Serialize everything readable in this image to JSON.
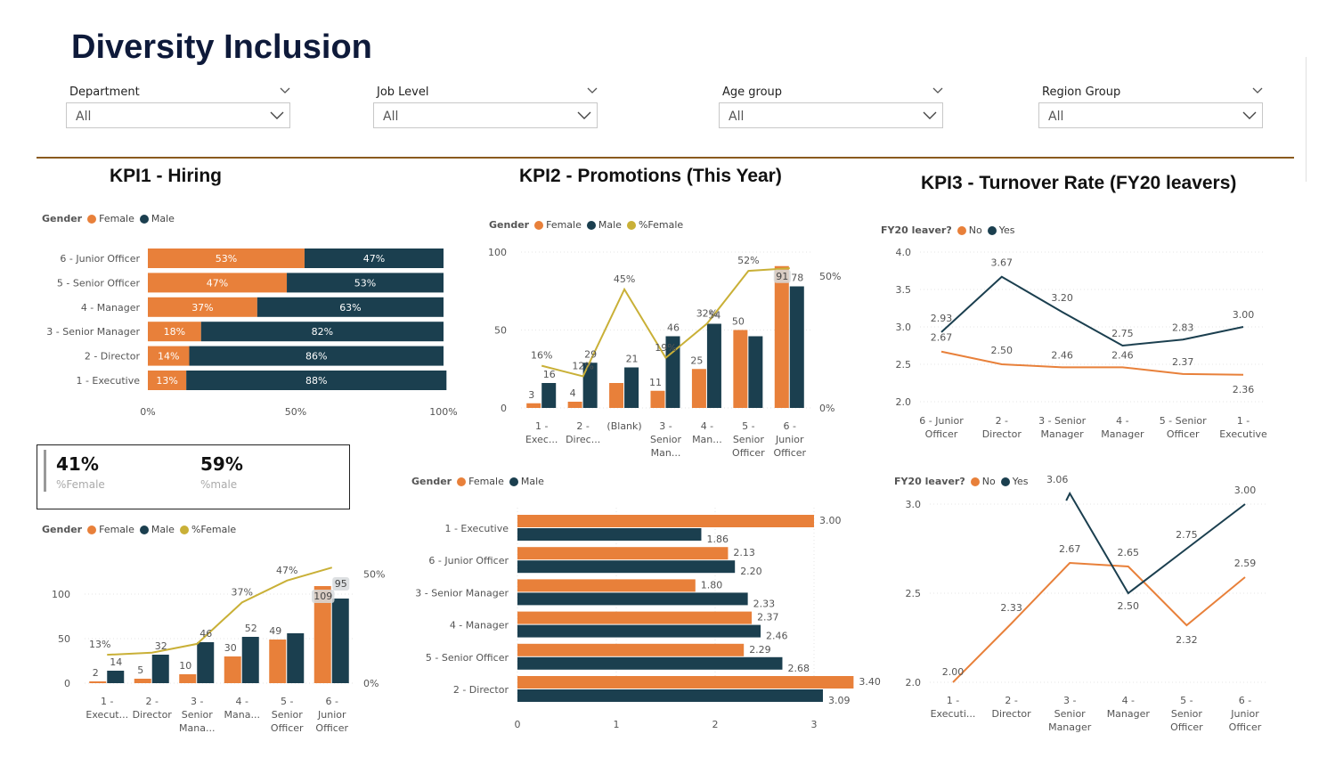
{
  "page": {
    "title": "Diversity Inclusion",
    "colors": {
      "female": "#e8803a",
      "male": "#1b3f4f",
      "pct": "#c9b037",
      "divider": "#8a5a1e"
    }
  },
  "filters": [
    {
      "label": "Department",
      "value": "All"
    },
    {
      "label": "Job Level",
      "value": "All"
    },
    {
      "label": "Age group",
      "value": "All"
    },
    {
      "label": "Region Group",
      "value": "All"
    }
  ],
  "sections": {
    "kpi1": "KPI1 - Hiring",
    "kpi2": "KPI2 - Promotions (This Year)",
    "kpi3": "KPI3 - Turnover Rate (FY20 leavers)"
  },
  "card": {
    "female_value": "41%",
    "female_label": "%Female",
    "male_value": "59%",
    "male_label": "%male"
  },
  "legends": {
    "gender": {
      "title": "Gender",
      "female": "Female",
      "male": "Male",
      "pct": "%Female"
    },
    "leaver": {
      "title": "FY20 leaver?",
      "no": "No",
      "yes": "Yes"
    }
  },
  "chart_data": [
    {
      "id": "hiring_stacked",
      "type": "bar",
      "orientation": "horizontal-stacked-100",
      "categories": [
        "6 - Junior Officer",
        "5 - Senior Officer",
        "4 - Manager",
        "3 - Senior Manager",
        "2 - Director",
        "1 - Executive"
      ],
      "series": [
        {
          "name": "Female",
          "values": [
            53,
            47,
            37,
            18,
            14,
            13
          ],
          "labels": [
            "53%",
            "47%",
            "37%",
            "18%",
            "14%",
            "13%"
          ]
        },
        {
          "name": "Male",
          "values": [
            47,
            53,
            63,
            82,
            86,
            88
          ],
          "labels": [
            "47%",
            "53%",
            "63%",
            "82%",
            "86%",
            "88%"
          ]
        }
      ],
      "xticks": [
        "0%",
        "50%",
        "100%"
      ],
      "xlim": [
        0,
        100
      ]
    },
    {
      "id": "hiring_combo",
      "type": "bar",
      "categories": [
        [
          "1 -",
          "Execut..."
        ],
        [
          "2 -",
          "Director"
        ],
        [
          "3 -",
          "Senior",
          "Mana..."
        ],
        [
          "4 -",
          "Mana..."
        ],
        [
          "5 -",
          "Senior",
          "Officer"
        ],
        [
          "6 -",
          "Junior",
          "Officer"
        ]
      ],
      "series": [
        {
          "name": "Female",
          "values": [
            2,
            5,
            10,
            30,
            49,
            109
          ]
        },
        {
          "name": "Male",
          "values": [
            14,
            32,
            46,
            52,
            56,
            95
          ]
        },
        {
          "name": "%Female",
          "type": "line",
          "values": [
            13,
            14,
            18,
            37,
            47,
            53
          ],
          "labels": [
            "13%",
            "",
            "",
            "37%",
            "47%",
            ""
          ]
        }
      ],
      "female_labels": [
        "2",
        "5",
        "10",
        "30",
        "49",
        "109"
      ],
      "male_labels": [
        "14",
        "32",
        "46",
        "52",
        "",
        "95"
      ],
      "ylim": [
        0,
        120
      ],
      "yticks": [
        "0",
        "50",
        "100"
      ],
      "y2ticks": [
        "0%",
        "50%"
      ]
    },
    {
      "id": "promotions_combo",
      "type": "bar",
      "categories": [
        [
          "1 -",
          "Exec..."
        ],
        [
          "2 -",
          "Direc..."
        ],
        [
          "(Blank)"
        ],
        [
          "3 -",
          "Senior",
          "Man..."
        ],
        [
          "4 -",
          "Man..."
        ],
        [
          "5 -",
          "Senior",
          "Officer"
        ],
        [
          "6 -",
          "Junior",
          "Officer"
        ]
      ],
      "series": [
        {
          "name": "Female",
          "values": [
            3,
            4,
            16,
            11,
            25,
            50,
            91
          ]
        },
        {
          "name": "Male",
          "values": [
            16,
            29,
            26,
            46,
            54,
            46,
            78
          ]
        },
        {
          "name": "%Female",
          "type": "line",
          "values": [
            16,
            12,
            45,
            19,
            32,
            52,
            53
          ],
          "labels": [
            "16%",
            "12%",
            "45%",
            "19%",
            "32%",
            "52%",
            ""
          ]
        }
      ],
      "female_labels": [
        "3",
        "4",
        "",
        "11",
        "25",
        "50",
        "91"
      ],
      "male_labels": [
        "16",
        "29",
        "21",
        "46",
        "54",
        "",
        "78"
      ],
      "ylim": [
        0,
        100
      ],
      "yticks": [
        "0",
        "50",
        "100"
      ],
      "y2ticks": [
        "0%",
        "50%"
      ]
    },
    {
      "id": "promotions_hbar",
      "type": "bar",
      "orientation": "horizontal-clustered",
      "categories": [
        "1 - Executive",
        "6 - Junior Officer",
        "3 - Senior Manager",
        "4 - Manager",
        "5 - Senior Officer",
        "2 - Director"
      ],
      "series": [
        {
          "name": "Female",
          "values": [
            3.0,
            2.13,
            1.8,
            2.37,
            2.29,
            3.4
          ],
          "labels": [
            "3.00",
            "2.13",
            "1.80",
            "2.37",
            "2.29",
            "3.40"
          ]
        },
        {
          "name": "Male",
          "values": [
            1.86,
            2.2,
            2.33,
            2.46,
            2.68,
            3.09
          ],
          "labels": [
            "1.86",
            "2.20",
            "2.33",
            "2.46",
            "2.68",
            "3.09"
          ]
        }
      ],
      "xlim": [
        0,
        3.5
      ],
      "xticks": [
        "0",
        "1",
        "2",
        "3"
      ]
    },
    {
      "id": "turnover_line1",
      "type": "line",
      "categories": [
        [
          "6 - Junior",
          "Officer"
        ],
        [
          "2 -",
          "Director"
        ],
        [
          "3 - Senior",
          "Manager"
        ],
        [
          "4 -",
          "Manager"
        ],
        [
          "5 - Senior",
          "Officer"
        ],
        [
          "1 -",
          "Executive"
        ]
      ],
      "series": [
        {
          "name": "No",
          "values": [
            2.67,
            2.5,
            2.46,
            2.46,
            2.37,
            2.36
          ],
          "labels": [
            "2.67",
            "2.50",
            "2.46",
            "2.46",
            "2.37",
            "2.36"
          ]
        },
        {
          "name": "Yes",
          "values": [
            2.93,
            3.67,
            3.2,
            2.75,
            2.83,
            3.0
          ],
          "labels": [
            "2.93",
            "3.67",
            "3.20",
            "2.75",
            "2.83",
            "3.00"
          ]
        }
      ],
      "ylim": [
        2.0,
        4.0
      ],
      "yticks": [
        "2.0",
        "2.5",
        "3.0",
        "3.5",
        "4.0"
      ]
    },
    {
      "id": "turnover_line2",
      "type": "line",
      "categories": [
        [
          "1 -",
          "Executi..."
        ],
        [
          "2 -",
          "Director"
        ],
        [
          "3 -",
          "Senior",
          "Manager"
        ],
        [
          "4 -",
          "Manager"
        ],
        [
          "5 -",
          "Senior",
          "Officer"
        ],
        [
          "6 -",
          "Junior",
          "Officer"
        ]
      ],
      "series": [
        {
          "name": "No",
          "values": [
            2.0,
            2.33,
            2.67,
            2.65,
            2.32,
            2.59
          ],
          "labels": [
            "2.00",
            "2.33",
            "2.67",
            "2.65",
            "2.32",
            "2.59"
          ]
        },
        {
          "name": "Yes",
          "values": [
            null,
            null,
            3.06,
            2.5,
            2.75,
            3.0
          ],
          "labels": [
            "",
            "",
            "3.06",
            "2.50",
            "2.75",
            "3.00"
          ]
        }
      ],
      "ylim": [
        2.0,
        3.0
      ],
      "yticks": [
        "2.0",
        "2.5",
        "3.0"
      ]
    }
  ]
}
